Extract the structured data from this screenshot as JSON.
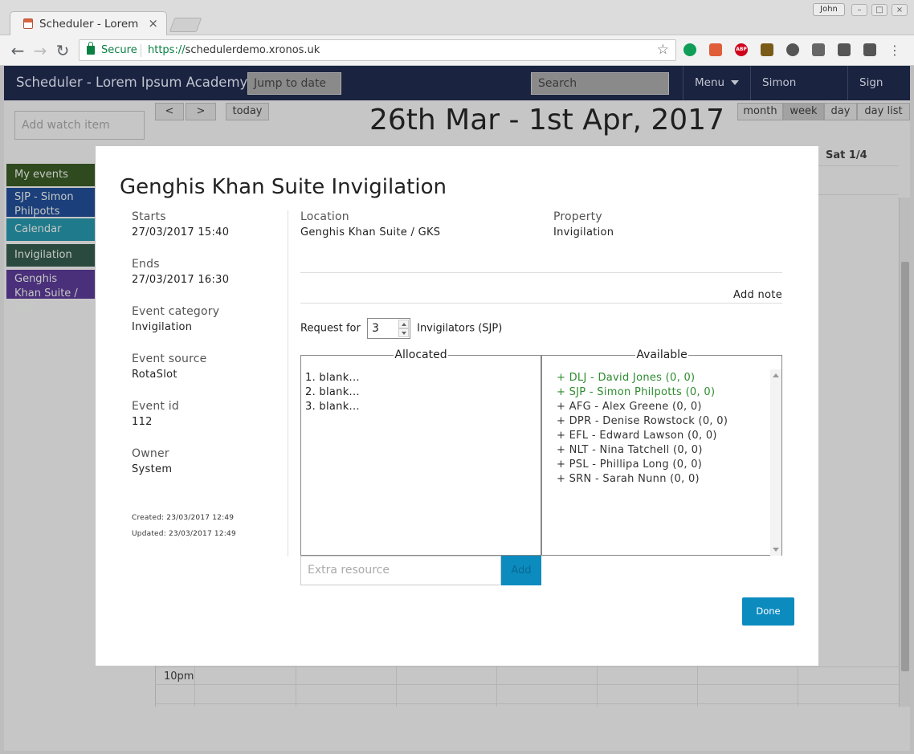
{
  "browser": {
    "tab_title": "Scheduler - Lorem Ipsum Academy",
    "profile": "John",
    "secure_label": "Secure",
    "url_scheme": "https://",
    "url_host": "schedulerdemo.xronos.uk"
  },
  "header": {
    "title": "Scheduler - Lorem Ipsum Academy",
    "jump_placeholder": "Jump to date",
    "search_placeholder": "Search",
    "menu_label": "Menu",
    "user_label": "Simon Philpotts",
    "signout_label": "Sign out"
  },
  "sidebar": {
    "watch_placeholder": "Add watch item",
    "items": [
      {
        "label": "My events",
        "color": "#2f4a1e"
      },
      {
        "label": "SJP - Simon Philpotts",
        "color": "#1b3f7a"
      },
      {
        "label": "Calendar",
        "color": "#1f7a8c"
      },
      {
        "label": "Invigilation",
        "color": "#2b4a3f"
      },
      {
        "label": "Genghis Khan Suite / GKS",
        "color": "#4a2f7a"
      }
    ]
  },
  "calendar": {
    "prev_label": "<",
    "next_label": ">",
    "today_label": "today",
    "range_title": "26th Mar - 1st Apr, 2017",
    "views": [
      "month",
      "week",
      "day",
      "day list"
    ],
    "active_view": "week",
    "visible_day_header": "Sat 1/4",
    "visible_time": "10pm"
  },
  "modal": {
    "title": "Genghis Khan Suite Invigilation",
    "meta": [
      {
        "label": "Starts",
        "value": "27/03/2017 15:40"
      },
      {
        "label": "Ends",
        "value": "27/03/2017 16:30"
      },
      {
        "label": "Event category",
        "value": "Invigilation"
      },
      {
        "label": "Event source",
        "value": "RotaSlot"
      },
      {
        "label": "Event id",
        "value": "112"
      },
      {
        "label": "Owner",
        "value": "System"
      }
    ],
    "created": "Created:  23/03/2017 12:49",
    "updated": "Updated:  23/03/2017 12:49",
    "location_label": "Location",
    "location_value": "Genghis Khan Suite / GKS",
    "property_label": "Property",
    "property_value": "Invigilation",
    "add_note_label": "Add note",
    "request_prefix": "Request for",
    "request_count": "3",
    "request_suffix": "Invigilators (SJP)",
    "allocated_title": "Allocated",
    "allocated": [
      "1. blank...",
      "2. blank...",
      "3. blank..."
    ],
    "available_title": "Available",
    "available": [
      {
        "text": "+ DLJ - David Jones (0, 0)",
        "highlight": true
      },
      {
        "text": "+ SJP - Simon Philpotts (0, 0)",
        "highlight": true
      },
      {
        "text": "+ AFG - Alex Greene (0, 0)",
        "highlight": false
      },
      {
        "text": "+ DPR - Denise Rowstock (0, 0)",
        "highlight": false
      },
      {
        "text": "+ EFL - Edward Lawson (0, 0)",
        "highlight": false
      },
      {
        "text": "+ NLT - Nina Tatchell (0, 0)",
        "highlight": false
      },
      {
        "text": "+ PSL - Phillipa Long (0, 0)",
        "highlight": false
      },
      {
        "text": "+ SRN - Sarah Nunn (0, 0)",
        "highlight": false
      }
    ],
    "extra_placeholder": "Extra resource",
    "add_label": "Add",
    "done_label": "Done"
  }
}
